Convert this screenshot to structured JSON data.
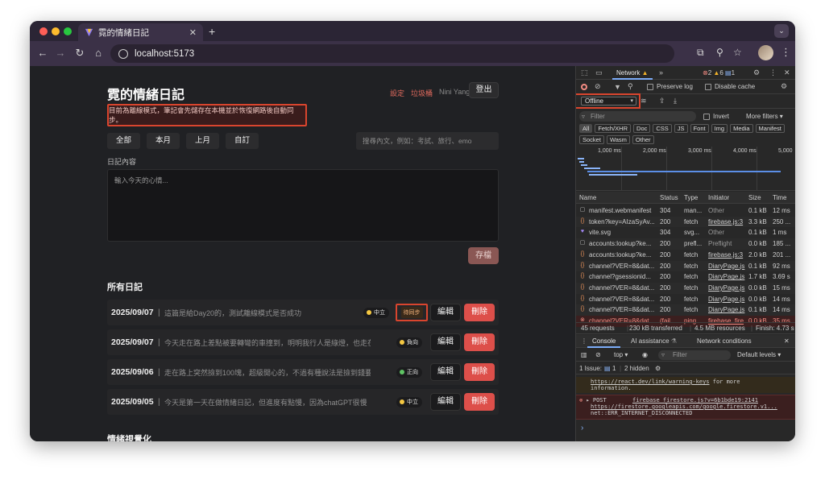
{
  "browser": {
    "tab_title": "霓的情緒日記",
    "url": "localhost:5173"
  },
  "app": {
    "title": "霓的情緒日記",
    "links": {
      "settings": "設定",
      "trash": "垃圾桶",
      "user": "Nini Yang"
    },
    "logout": "登出",
    "offline_banner": "目前為離線模式，筆記會先儲存在本機並於恢復網路後自動同步。",
    "filters": [
      "全部",
      "本月",
      "上月",
      "自訂"
    ],
    "search_placeholder": "搜尋內文，例如：考試、旅行、emo",
    "content_label": "日記內容",
    "textarea_placeholder": "輸入今天的心情...",
    "save": "存檔",
    "all_entries_title": "所有日記",
    "visualization_title": "情緒視覺化",
    "edit": "編輯",
    "delete": "刪除",
    "pending_label": "待同步",
    "entries": [
      {
        "date": "2025/09/07",
        "text": "這篇是給Day20的，測試離線模式是否成功",
        "mood": "中立",
        "mood_color": "#f5c842",
        "pending": true
      },
      {
        "date": "2025/09/07",
        "text": "今天走在路上差點被要轉彎的車撞到，明明我行人是綠燈，也走在斑馬線上",
        "mood": "負向",
        "mood_color": "#f5c842",
        "pending": false
      },
      {
        "date": "2025/09/06",
        "text": "走在路上突然撿到100塊，超級開心的，不過有種說法是撿到錢要捐出去",
        "mood": "正向",
        "mood_color": "#5fc464",
        "pending": false
      },
      {
        "date": "2025/09/05",
        "text": "今天是第一天在做情緒日記，但進度有點慢，因為chatGPT很慢",
        "mood": "中立",
        "mood_color": "#f5c842",
        "pending": false
      }
    ]
  },
  "devtools": {
    "network_tab": "Network",
    "err_count": "2",
    "warn_count": "6",
    "info_count": "1",
    "preserve_log": "Preserve log",
    "disable_cache": "Disable cache",
    "throttle": "Offline",
    "filter_placeholder": "Filter",
    "invert": "Invert",
    "more_filters": "More filters",
    "chips": [
      "All",
      "Fetch/XHR",
      "Doc",
      "CSS",
      "JS",
      "Font",
      "Img",
      "Media",
      "Manifest",
      "Socket",
      "Wasm",
      "Other"
    ],
    "timeline_labels": [
      "1,000 ms",
      "2,000 ms",
      "3,000 ms",
      "4,000 ms",
      "5,000"
    ],
    "columns": [
      "Name",
      "Status",
      "Type",
      "Initiator",
      "Size",
      "Time"
    ],
    "rows": [
      {
        "name": "manifest.webmanifest",
        "status": "304",
        "type": "man...",
        "initiator": "Other",
        "size": "0.1 kB",
        "time": "12 ms",
        "icon": "doc",
        "err": false,
        "link": false
      },
      {
        "name": "token?key=AIzaSyAv...",
        "status": "200",
        "type": "fetch",
        "initiator": "firebase.js:3",
        "size": "3.3 kB",
        "time": "250 ...",
        "icon": "xhr",
        "err": false,
        "link": true
      },
      {
        "name": "vite.svg",
        "status": "304",
        "type": "svg...",
        "initiator": "Other",
        "size": "0.1 kB",
        "time": "1 ms",
        "icon": "img",
        "err": false,
        "link": false
      },
      {
        "name": "accounts:lookup?ke...",
        "status": "200",
        "type": "prefl...",
        "initiator": "Preflight",
        "size": "0.0 kB",
        "time": "185 ...",
        "icon": "doc",
        "err": false,
        "link": false
      },
      {
        "name": "accounts:lookup?ke...",
        "status": "200",
        "type": "fetch",
        "initiator": "firebase.js:3",
        "size": "2.0 kB",
        "time": "201 ...",
        "icon": "xhr",
        "err": false,
        "link": true
      },
      {
        "name": "channel?VER=8&dat...",
        "status": "200",
        "type": "fetch",
        "initiator": "DiaryPage.js",
        "size": "0.1 kB",
        "time": "92 ms",
        "icon": "xhr",
        "err": false,
        "link": true
      },
      {
        "name": "channel?gsessionid...",
        "status": "200",
        "type": "fetch",
        "initiator": "DiaryPage.js",
        "size": "1.7 kB",
        "time": "3.69 s",
        "icon": "xhr",
        "err": false,
        "link": true
      },
      {
        "name": "channel?VER=8&dat...",
        "status": "200",
        "type": "fetch",
        "initiator": "DiaryPage.js",
        "size": "0.0 kB",
        "time": "15 ms",
        "icon": "xhr",
        "err": false,
        "link": true
      },
      {
        "name": "channel?VER=8&dat...",
        "status": "200",
        "type": "fetch",
        "initiator": "DiaryPage.js",
        "size": "0.0 kB",
        "time": "14 ms",
        "icon": "xhr",
        "err": false,
        "link": true
      },
      {
        "name": "channel?VER=8&dat...",
        "status": "200",
        "type": "fetch",
        "initiator": "DiaryPage.js",
        "size": "0.1 kB",
        "time": "14 ms",
        "icon": "xhr",
        "err": false,
        "link": true
      },
      {
        "name": "channel?VER=8&dat...",
        "status": "(fail...",
        "type": "ping",
        "initiator": "firebase_fire",
        "size": "0.0 kB",
        "time": "35 ms",
        "icon": "err",
        "err": true,
        "link": true
      }
    ],
    "summary": {
      "requests": "45 requests",
      "transferred": "230 kB transferred",
      "resources": "4.5 MB resources",
      "finish": "Finish: 4.73 s"
    },
    "drawer_tabs": [
      "Console",
      "AI assistance",
      "Network conditions"
    ],
    "console_context": "top",
    "console_filter": "Filter",
    "default_levels": "Default levels",
    "issues": "1 Issue:",
    "issues_count": "1",
    "hidden": "2 hidden",
    "console_lines": {
      "link": "https://react.dev/link/warning-keys",
      "info_tail": "for more",
      "info_tail2": "information.",
      "post": "POST",
      "post_src": "firebase_firestore.js?v=6b1bde19:2141",
      "post_url": "https://firestore.googleapis.com/google.firestore.v1...",
      "post_err": "net::ERR_INTERNET_DISCONNECTED"
    },
    "prompt": "›"
  }
}
